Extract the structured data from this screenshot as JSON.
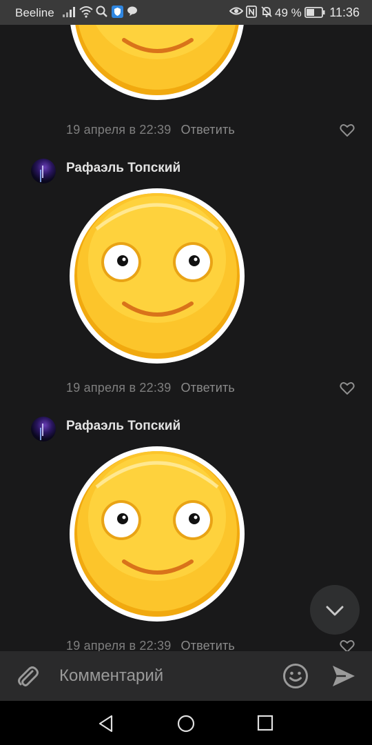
{
  "status_bar": {
    "carrier": "Beeline",
    "battery_percent": "49 %",
    "time": "11:36",
    "icons": [
      "signal-icon",
      "wifi-icon",
      "search-icon",
      "shield-icon",
      "message-icon",
      "eye-icon",
      "nfc-icon",
      "bell-off-icon",
      "battery-icon"
    ]
  },
  "comments": [
    {
      "author": "",
      "sticker": "smiley-sticker",
      "date": "19 апреля в 22:39",
      "reply_label": "Ответить"
    },
    {
      "author": "Рафаэль Топский",
      "sticker": "smiley-sticker",
      "date": "19 апреля в 22:39",
      "reply_label": "Ответить"
    },
    {
      "author": "Рафаэль Топский",
      "sticker": "smiley-sticker",
      "date": "19 апреля в 22:39",
      "reply_label": "Ответить"
    }
  ],
  "composer": {
    "placeholder": "Комментарий",
    "value": ""
  },
  "colors": {
    "background": "#19191a",
    "sticker_yellow": "#fcc42a",
    "mouth": "#d9731a",
    "text_muted": "#7f7f7f"
  }
}
